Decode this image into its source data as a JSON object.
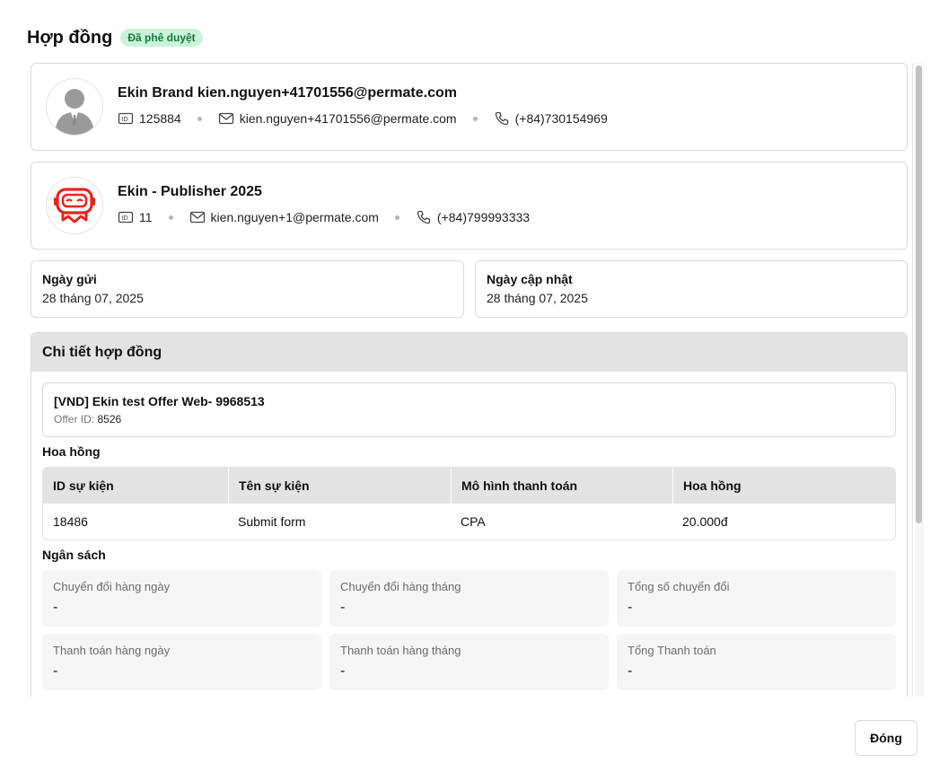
{
  "dialog": {
    "title": "Hợp đồng",
    "status_badge": "Đã phê duyệt",
    "close_label": "Đóng"
  },
  "advertiser": {
    "name": "Ekin Brand kien.nguyen+41701556@permate.com",
    "id": "125884",
    "email": "kien.nguyen+41701556@permate.com",
    "phone": "(+84)730154969",
    "avatar_icon": "person-silhouette-icon"
  },
  "publisher": {
    "name": "Ekin - Publisher 2025",
    "id": "11",
    "email": "kien.nguyen+1@permate.com",
    "phone": "(+84)799993333",
    "avatar_icon": "robot-logo-icon"
  },
  "dates": {
    "sent_label": "Ngày gửi",
    "sent_value": "28 tháng 07, 2025",
    "updated_label": "Ngày cập nhật",
    "updated_value": "28 tháng 07, 2025"
  },
  "details": {
    "heading": "Chi tiết hợp đồng",
    "offer_name": "[VND] Ekin test Offer Web- 9968513",
    "offer_id_label": "Offer ID:",
    "offer_id": "8526",
    "commission_heading": "Hoa hồng",
    "commission_columns": [
      "ID sự kiện",
      "Tên sự kiện",
      "Mô hình thanh toán",
      "Hoa hồng"
    ],
    "commission_rows": [
      [
        "18486",
        "Submit form",
        "CPA",
        "20.000đ"
      ]
    ],
    "budget_heading": "Ngân sách",
    "budget_items": [
      {
        "label": "Chuyển đổi hàng ngày",
        "value": "-"
      },
      {
        "label": "Chuyển đổi hàng tháng",
        "value": "-"
      },
      {
        "label": "Tổng số chuyển đổi",
        "value": "-"
      },
      {
        "label": "Thanh toán hàng ngày",
        "value": "-"
      },
      {
        "label": "Thanh toán hàng tháng",
        "value": "-"
      },
      {
        "label": "Tổng Thanh toán",
        "value": "-"
      }
    ]
  },
  "colors": {
    "badge_bg": "#c9f2d8",
    "badge_text": "#137a3a",
    "header_gray": "#e3e3e3",
    "logo_red": "#e8231f"
  }
}
